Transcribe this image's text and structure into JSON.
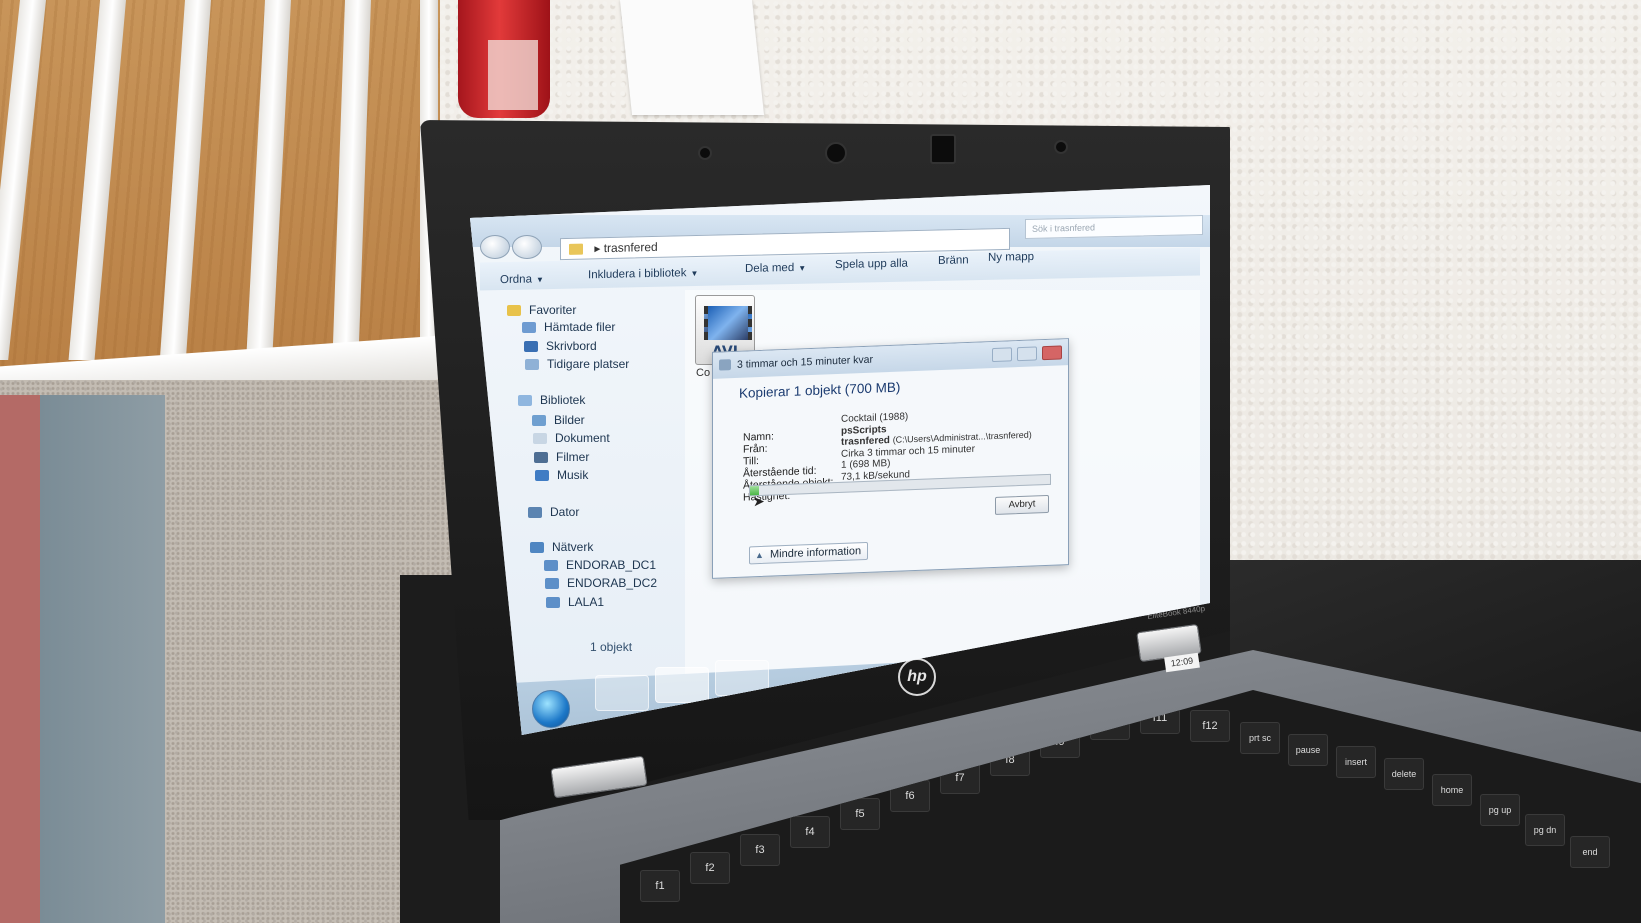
{
  "explorer": {
    "address_folder": "trasnfered",
    "search_placeholder": "Sök i trasnfered",
    "toolbar": {
      "organize": "Ordna",
      "include_library": "Inkludera i bibliotek",
      "share": "Dela med",
      "play_all": "Spela upp alla",
      "burn": "Bränn",
      "new_folder": "Ny mapp"
    },
    "sidebar": {
      "favorites": "Favoriter",
      "downloads": "Hämtade filer",
      "desktop": "Skrivbord",
      "recent": "Tidigare platser",
      "libraries": "Bibliotek",
      "pictures": "Bilder",
      "documents": "Dokument",
      "videos": "Filmer",
      "music": "Musik",
      "computer": "Dator",
      "network": "Nätverk",
      "net_items": [
        "ENDORAB_DC1",
        "ENDORAB_DC2",
        "LALA1"
      ]
    },
    "file": {
      "icon_label": "AVI",
      "caption": "Co"
    },
    "status": "1 objekt"
  },
  "copy_dialog": {
    "title": "3 timmar och 15 minuter kvar",
    "heading": "Kopierar 1 objekt (700 MB)",
    "labels": {
      "name": "Namn:",
      "from": "Från:",
      "to": "Till:",
      "time_left": "Återstående tid:",
      "items_left": "Återstående objekt:",
      "speed": "Hastighet:"
    },
    "values": {
      "name": "Cocktail (1988)",
      "from": "psScripts",
      "to": "trasnfered",
      "to_path": "(C:\\Users\\Administrat...\\trasnfered)",
      "time_left": "Cirka 3 timmar och 15 minuter",
      "items_left": "1 (698 MB)",
      "speed": "73,1 kB/sekund"
    },
    "progress": 0.03,
    "cancel": "Avbryt",
    "less_info": "Mindre information"
  },
  "laptop": {
    "brand": "hp",
    "model": "EliteBook 8440p",
    "sticker": "12:09"
  },
  "keyboard_keys": [
    "f1",
    "f2",
    "f3",
    "f4",
    "f5",
    "f6",
    "f7",
    "f8",
    "f9",
    "f10",
    "f11",
    "f12",
    "prt sc",
    "pause",
    "insert",
    "delete",
    "home",
    "pg up",
    "pg dn",
    "end"
  ],
  "colors": {
    "dialog_accent": "#1b3b70",
    "progress_green": "#4ab546",
    "win7_blue": "#1d78c8"
  }
}
